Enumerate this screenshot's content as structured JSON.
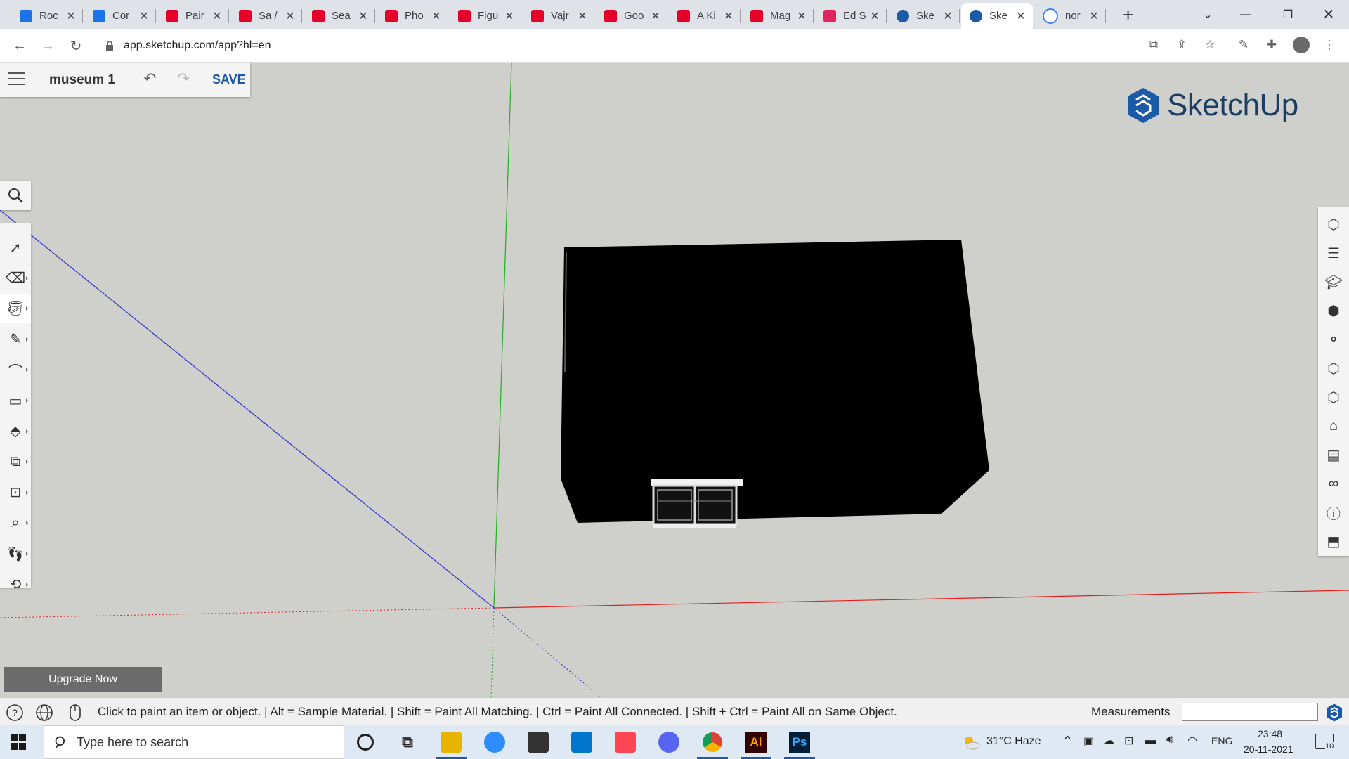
{
  "browser": {
    "tabs": [
      {
        "title": "Roc",
        "favicon": "google-classroom-icon",
        "color": "#1a73e8"
      },
      {
        "title": "Cor",
        "favicon": "google-classroom-icon",
        "color": "#1a73e8"
      },
      {
        "title": "Pair",
        "favicon": "met-museum-icon",
        "color": "#e4002b"
      },
      {
        "title": "Sa /",
        "favicon": "met-museum-icon",
        "color": "#e4002b"
      },
      {
        "title": "Sea",
        "favicon": "met-museum-icon",
        "color": "#e4002b"
      },
      {
        "title": "Pho",
        "favicon": "met-museum-icon",
        "color": "#e4002b"
      },
      {
        "title": "Figu",
        "favicon": "met-museum-icon",
        "color": "#e4002b"
      },
      {
        "title": "Vajr",
        "favicon": "met-museum-icon",
        "color": "#e4002b"
      },
      {
        "title": "Goo",
        "favicon": "met-museum-icon",
        "color": "#e4002b"
      },
      {
        "title": "A Ki",
        "favicon": "met-museum-icon",
        "color": "#e4002b"
      },
      {
        "title": "Mag",
        "favicon": "met-museum-icon",
        "color": "#e4002b"
      },
      {
        "title": "Ed S",
        "favicon": "music-icon",
        "color": "#e0245e"
      },
      {
        "title": "Ske",
        "favicon": "sketchup-icon",
        "color": "#1b5aa6"
      },
      {
        "title": "Ske",
        "favicon": "sketchup-icon",
        "color": "#1b5aa6",
        "active": true
      },
      {
        "title": "nor",
        "favicon": "google-icon",
        "color": "#4285f4"
      }
    ],
    "new_tab": "+",
    "url": "app.sketchup.com/app?hl=en"
  },
  "app": {
    "document_title": "museum 1",
    "save_label": "SAVE",
    "logo_text": "SketchUp",
    "upgrade_label": "Upgrade Now",
    "left_tools": [
      "select-tool-icon",
      "eraser-tool-icon",
      "paint-bucket-tool-icon",
      "pencil-tool-icon",
      "arc-tool-icon",
      "rectangle-tool-icon",
      "push-pull-tool-icon",
      "move-tool-icon",
      "tape-measure-tool-icon",
      "text-tool-icon",
      "walk-tool-icon",
      "orbit-tool-icon"
    ],
    "right_panels": [
      "entity-info-icon",
      "outliner-icon",
      "instructor-icon",
      "components-icon",
      "materials-icon",
      "styles-icon",
      "display-icon",
      "tags-icon",
      "scenes-icon",
      "view-icon",
      "info-icon",
      "export-icon"
    ],
    "status": {
      "hint": "Click to paint an item or object. | Alt = Sample Material. | Shift = Paint All Matching. | Ctrl = Paint All Connected. | Shift + Ctrl = Paint All on Same Object.",
      "measurements_label": "Measurements",
      "measurements_value": ""
    },
    "colors": {
      "axis_red": "#e02020",
      "axis_green": "#20b020",
      "axis_blue": "#2020d0",
      "brand": "#1b5aa6"
    }
  },
  "taskbar": {
    "search_placeholder": "Type here to search",
    "apps": [
      "cortana-icon",
      "task-view-icon",
      "file-explorer-icon",
      "zoom-icon",
      "store-icon",
      "dell-icon",
      "valorant-icon",
      "discord-icon",
      "chrome-icon",
      "illustrator-icon",
      "photoshop-icon"
    ],
    "illustrator_label": "Ai",
    "photoshop_label": "Ps",
    "weather": "31°C  Haze",
    "language": "ENG",
    "time": "23:48",
    "date": "20-11-2021",
    "notification_count": "10"
  }
}
